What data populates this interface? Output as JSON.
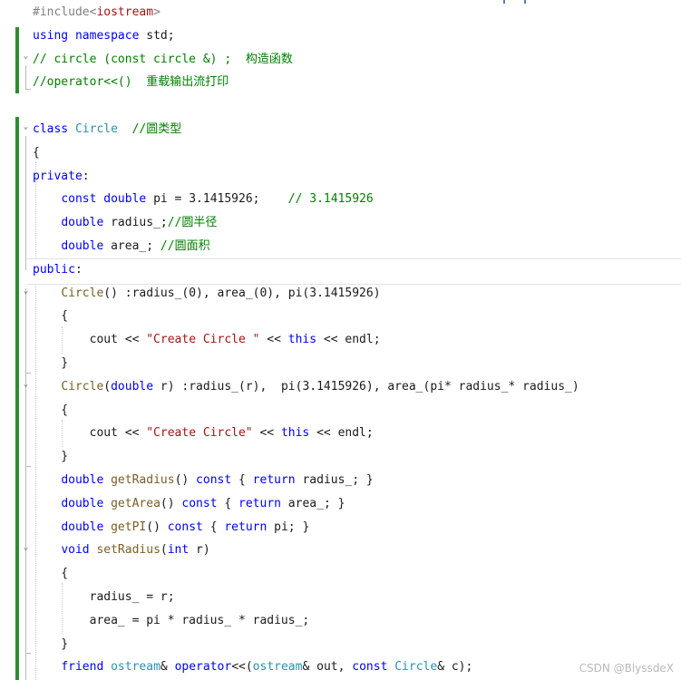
{
  "editor": {
    "language": "C++",
    "lines": [
      [
        [
          "pp",
          "#include<"
        ],
        [
          "st",
          "iostream"
        ],
        [
          "pp",
          ">"
        ]
      ],
      [
        [
          "kw",
          "using"
        ],
        [
          "tx",
          " "
        ],
        [
          "kw",
          "namespace"
        ],
        [
          "tx",
          " std;"
        ]
      ],
      [
        [
          "cm",
          "// circle (const circle &) ;  "
        ],
        [
          "cmc",
          "构造函数"
        ]
      ],
      [
        [
          "cm",
          "//operator<<()  "
        ],
        [
          "cmc",
          "重载输出流打印"
        ]
      ],
      [],
      [
        [
          "kw",
          "class"
        ],
        [
          "tx",
          " "
        ],
        [
          "ty",
          "Circle"
        ],
        [
          "tx",
          "  "
        ],
        [
          "cm",
          "//"
        ],
        [
          "cmc",
          "圆类型"
        ]
      ],
      [
        [
          "tx",
          "{"
        ]
      ],
      [
        [
          "kw",
          "private"
        ],
        [
          "tx",
          ":"
        ]
      ],
      [
        [
          "tx",
          "    "
        ],
        [
          "kw",
          "const"
        ],
        [
          "tx",
          " "
        ],
        [
          "kw",
          "double"
        ],
        [
          "tx",
          " pi = 3.1415926;    "
        ],
        [
          "cm",
          "// 3.1415926"
        ]
      ],
      [
        [
          "tx",
          "    "
        ],
        [
          "kw",
          "double"
        ],
        [
          "tx",
          " radius_;"
        ],
        [
          "cm",
          "//"
        ],
        [
          "cmc",
          "圆半径"
        ]
      ],
      [
        [
          "tx",
          "    "
        ],
        [
          "kw",
          "double"
        ],
        [
          "tx",
          " area_; "
        ],
        [
          "cm",
          "//"
        ],
        [
          "cmc",
          "圆面积"
        ]
      ],
      [
        [
          "kw",
          "public"
        ],
        [
          "tx",
          ":"
        ]
      ],
      [
        [
          "tx",
          "    "
        ],
        [
          "fn",
          "Circle"
        ],
        [
          "tx",
          "() :radius_(0), area_(0), pi(3.1415926)"
        ]
      ],
      [
        [
          "tx",
          "    {"
        ]
      ],
      [
        [
          "tx",
          "        cout << "
        ],
        [
          "st",
          "\"Create Circle \""
        ],
        [
          "tx",
          " << "
        ],
        [
          "kw",
          "this"
        ],
        [
          "tx",
          " << endl;"
        ]
      ],
      [
        [
          "tx",
          "    }"
        ]
      ],
      [
        [
          "tx",
          "    "
        ],
        [
          "fn",
          "Circle"
        ],
        [
          "tx",
          "("
        ],
        [
          "kw",
          "double"
        ],
        [
          "tx",
          " r) :radius_(r),  pi(3.1415926), area_(pi* radius_* radius_)"
        ]
      ],
      [
        [
          "tx",
          "    {"
        ]
      ],
      [
        [
          "tx",
          "        cout << "
        ],
        [
          "st",
          "\"Create Circle\""
        ],
        [
          "tx",
          " << "
        ],
        [
          "kw",
          "this"
        ],
        [
          "tx",
          " << endl;"
        ]
      ],
      [
        [
          "tx",
          "    }"
        ]
      ],
      [
        [
          "tx",
          "    "
        ],
        [
          "kw",
          "double"
        ],
        [
          "tx",
          " "
        ],
        [
          "fn",
          "getRadius"
        ],
        [
          "tx",
          "() "
        ],
        [
          "kw",
          "const"
        ],
        [
          "tx",
          " { "
        ],
        [
          "kw",
          "return"
        ],
        [
          "tx",
          " radius_; }"
        ]
      ],
      [
        [
          "tx",
          "    "
        ],
        [
          "kw",
          "double"
        ],
        [
          "tx",
          " "
        ],
        [
          "fn",
          "getArea"
        ],
        [
          "tx",
          "() "
        ],
        [
          "kw",
          "const"
        ],
        [
          "tx",
          " { "
        ],
        [
          "kw",
          "return"
        ],
        [
          "tx",
          " area_; }"
        ]
      ],
      [
        [
          "tx",
          "    "
        ],
        [
          "kw",
          "double"
        ],
        [
          "tx",
          " "
        ],
        [
          "fn",
          "getPI"
        ],
        [
          "tx",
          "() "
        ],
        [
          "kw",
          "const"
        ],
        [
          "tx",
          " { "
        ],
        [
          "kw",
          "return"
        ],
        [
          "tx",
          " pi; }"
        ]
      ],
      [
        [
          "tx",
          "    "
        ],
        [
          "kw",
          "void"
        ],
        [
          "tx",
          " "
        ],
        [
          "fn",
          "setRadius"
        ],
        [
          "tx",
          "("
        ],
        [
          "kw",
          "int"
        ],
        [
          "tx",
          " r)"
        ]
      ],
      [
        [
          "tx",
          "    {"
        ]
      ],
      [
        [
          "tx",
          "        radius_ = r;"
        ]
      ],
      [
        [
          "tx",
          "        area_ = pi * radius_ * radius_;"
        ]
      ],
      [
        [
          "tx",
          "    }"
        ]
      ],
      [
        [
          "tx",
          "    "
        ],
        [
          "kw",
          "friend"
        ],
        [
          "tx",
          " "
        ],
        [
          "ty",
          "ostream"
        ],
        [
          "tx",
          "& "
        ],
        [
          "kw",
          "operator"
        ],
        [
          "tx",
          "<<("
        ],
        [
          "ty",
          "ostream"
        ],
        [
          "tx",
          "& out, "
        ],
        [
          "kw",
          "const"
        ],
        [
          "tx",
          " "
        ],
        [
          "ty",
          "Circle"
        ],
        [
          "tx",
          "& c);"
        ]
      ]
    ],
    "fold_glyph": "⌄",
    "colors": {
      "keyword": "#0000ff",
      "type": "#2b91af",
      "comment": "#008000",
      "string": "#a31515",
      "preprocessor": "#808080",
      "change_bar": "#2e8b2e"
    }
  },
  "watermark": "CSDN @BlyssdeX"
}
